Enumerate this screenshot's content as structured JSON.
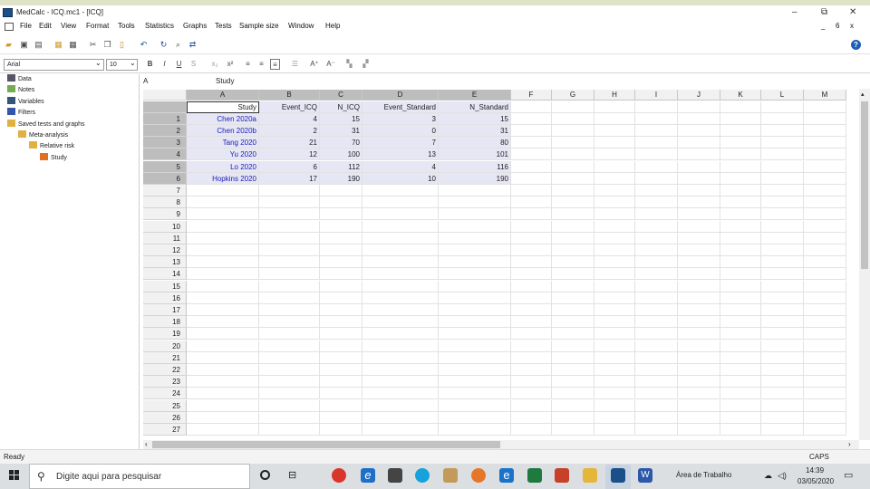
{
  "window": {
    "title": "MedCalc - ICQ.mc1 - [ICQ]",
    "minimize": "–",
    "restore": "⧉",
    "close": "✕",
    "mdi_minimize": "_",
    "mdi_restore": "6",
    "mdi_close": "x"
  },
  "menu": [
    "File",
    "Edit",
    "View",
    "Format",
    "Tools",
    "Statistics",
    "Graphs",
    "Tests",
    "Sample size",
    "Window",
    "Help"
  ],
  "toolbar2": {
    "font_name": "Arial",
    "font_size": "10",
    "bold": "B",
    "italic": "I",
    "underline": "U",
    "strike": "S",
    "subscript": "x₂",
    "superscript": "x²",
    "grow": "A⁺",
    "shrink": "A⁻"
  },
  "tree": [
    {
      "label": "Data",
      "indent": 0,
      "icon": "data-icon"
    },
    {
      "label": "Notes",
      "indent": 0,
      "icon": "notes-icon"
    },
    {
      "label": "Variables",
      "indent": 0,
      "icon": "variables-icon"
    },
    {
      "label": "Filters",
      "indent": 0,
      "icon": "filter-icon"
    },
    {
      "label": "Saved tests and graphs",
      "indent": 0,
      "icon": "folder-icon"
    },
    {
      "label": "Meta-analysis",
      "indent": 1,
      "icon": "folder-icon"
    },
    {
      "label": "Relative risk",
      "indent": 2,
      "icon": "folder-icon"
    },
    {
      "label": "Study",
      "indent": 3,
      "icon": "bar-chart-icon"
    }
  ],
  "cell_ref": "A",
  "cell_value": "Study",
  "columns": [
    "A",
    "B",
    "C",
    "D",
    "E",
    "F",
    "G",
    "H",
    "I",
    "J",
    "K",
    "L",
    "M"
  ],
  "headers": [
    "Study",
    "Event_ICQ",
    "N_ICQ",
    "Event_Standard",
    "N_Standard"
  ],
  "rows": [
    [
      "Chen 2020a",
      "4",
      "15",
      "3",
      "15"
    ],
    [
      "Chen 2020b",
      "2",
      "31",
      "0",
      "31"
    ],
    [
      "Tang 2020",
      "21",
      "70",
      "7",
      "80"
    ],
    [
      "Yu 2020",
      "12",
      "100",
      "13",
      "101"
    ],
    [
      "Lo 2020",
      "6",
      "112",
      "4",
      "116"
    ],
    [
      "Hopkins 2020",
      "17",
      "190",
      "10",
      "190"
    ]
  ],
  "row_count": 27,
  "status": {
    "left": "Ready",
    "right": "CAPS"
  },
  "taskbar": {
    "search_placeholder": "Digite aqui para pesquisar",
    "desktop_label": "Área de Trabalho",
    "time": "14:39",
    "date": "03/05/2020"
  }
}
